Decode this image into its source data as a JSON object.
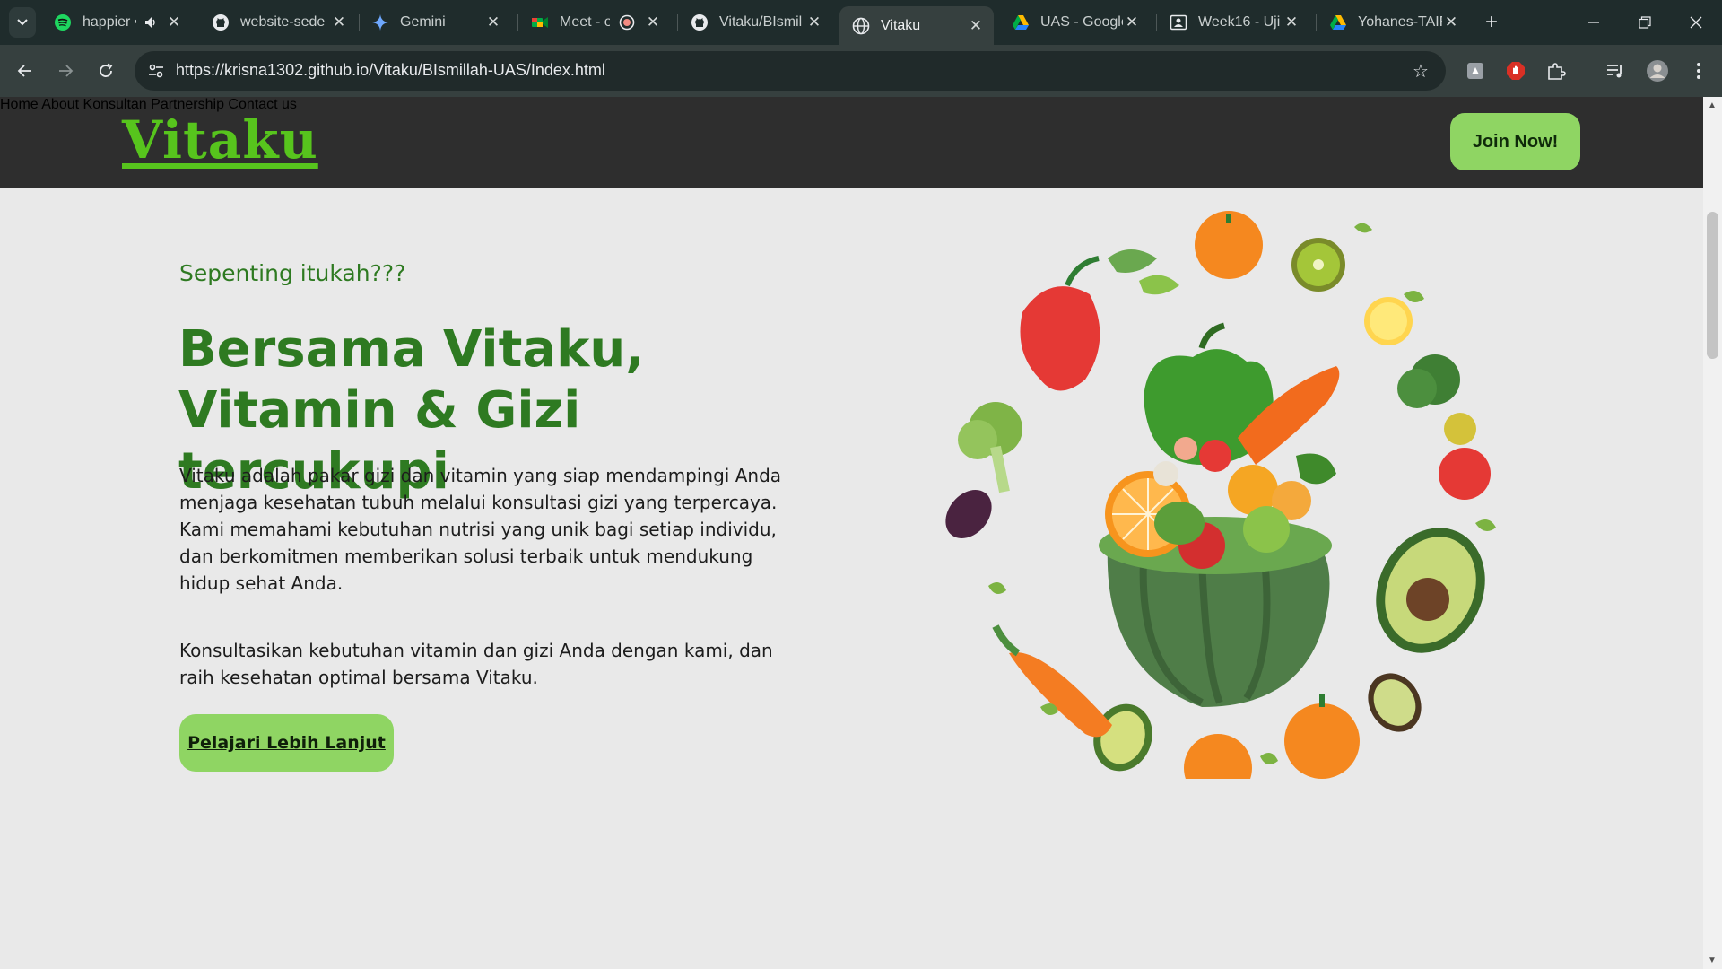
{
  "browser": {
    "tabs": [
      {
        "title": "happier •",
        "icon": "spotify-icon",
        "extra": "speaker-icon"
      },
      {
        "title": "website-sede",
        "icon": "github-icon"
      },
      {
        "title": "Gemini",
        "icon": "gemini-icon"
      },
      {
        "title": "Meet - ex",
        "icon": "meet-icon",
        "extra": "record-icon"
      },
      {
        "title": "Vitaku/BIsmil",
        "icon": "github-icon"
      },
      {
        "title": "Vitaku",
        "icon": "globe-icon",
        "active": true
      },
      {
        "title": "UAS - Google",
        "icon": "drive-icon"
      },
      {
        "title": "Week16 - Uji",
        "icon": "classroom-icon"
      },
      {
        "title": "Yohanes-TAIF",
        "icon": "drive-icon"
      }
    ],
    "url": "https://krisna1302.github.io/Vitaku/BIsmillah-UAS/Index.html"
  },
  "site": {
    "logo": "Vitaku",
    "nav": [
      "Home",
      "About",
      "Konsultan",
      "Partnership",
      "Contact us"
    ],
    "join_label": "Join Now!",
    "kicker": "Sepenting itukah???",
    "headline": "Bersama Vitaku, Vitamin & Gizi tercukupi",
    "paragraph1": "Vitaku adalah pakar gizi dan vitamin yang siap mendampingi Anda menjaga kesehatan tubuh melalui konsultasi gizi yang terpercaya. Kami memahami kebutuhan nutrisi yang unik bagi setiap individu, dan berkomitmen memberikan solusi terbaik untuk mendukung hidup sehat Anda.",
    "paragraph2": "Konsultasikan kebutuhan vitamin dan gizi Anda dengan kami, dan raih kesehatan optimal bersama Vitaku.",
    "cta_label": "Pelajari Lebih Lanjut"
  },
  "colors": {
    "accent_green": "#57c41d",
    "button_green": "#8fd563",
    "heading_green": "#2e7a21",
    "header_bg": "#2e2e2e"
  }
}
